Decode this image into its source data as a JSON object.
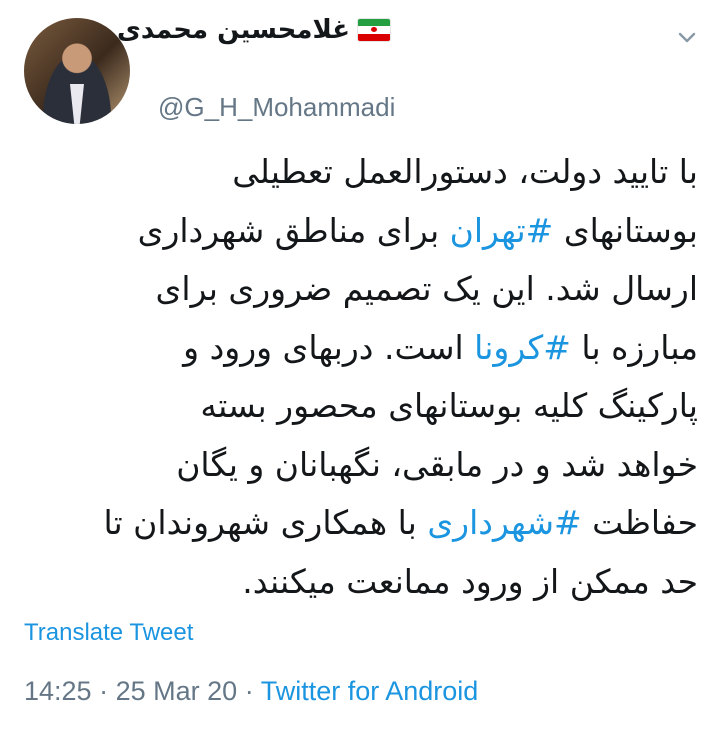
{
  "user": {
    "display_name": "غلامحسین محمدی",
    "handle": "@G_H_Mohammadi",
    "flag_icon": "iran-flag-icon"
  },
  "tweet": {
    "line1": "با تایید دولت، دستورالعمل تعطیلی",
    "line2_pre": "بوستانهای ",
    "line2_tag": "#تهران",
    "line2_post": " برای مناطق شهرداری",
    "line3": "ارسال شد. این یک تصمیم ضروری برای",
    "line4_pre": "مبارزه با ",
    "line4_tag": "#کرونا",
    "line4_post": " است. دربهای ورود و",
    "line5": "پارکینگ کلیه بوستانهای محصور بسته",
    "line6": "خواهد شد و در مابقی، نگهبانان و یگان",
    "line7_pre": "حفاظت ",
    "line7_tag": "#شهرداری",
    "line7_post": " با همکاری شهروندان تا",
    "line8": "حد ممکن از ورود ممانعت میکنند."
  },
  "translate_label": "Translate Tweet",
  "meta": {
    "time": "14:25",
    "separator": "·",
    "date": "25 Mar 20",
    "source": "Twitter for Android"
  },
  "colors": {
    "link": "#1b95e0",
    "secondary_text": "#657786",
    "text": "#14171a"
  }
}
